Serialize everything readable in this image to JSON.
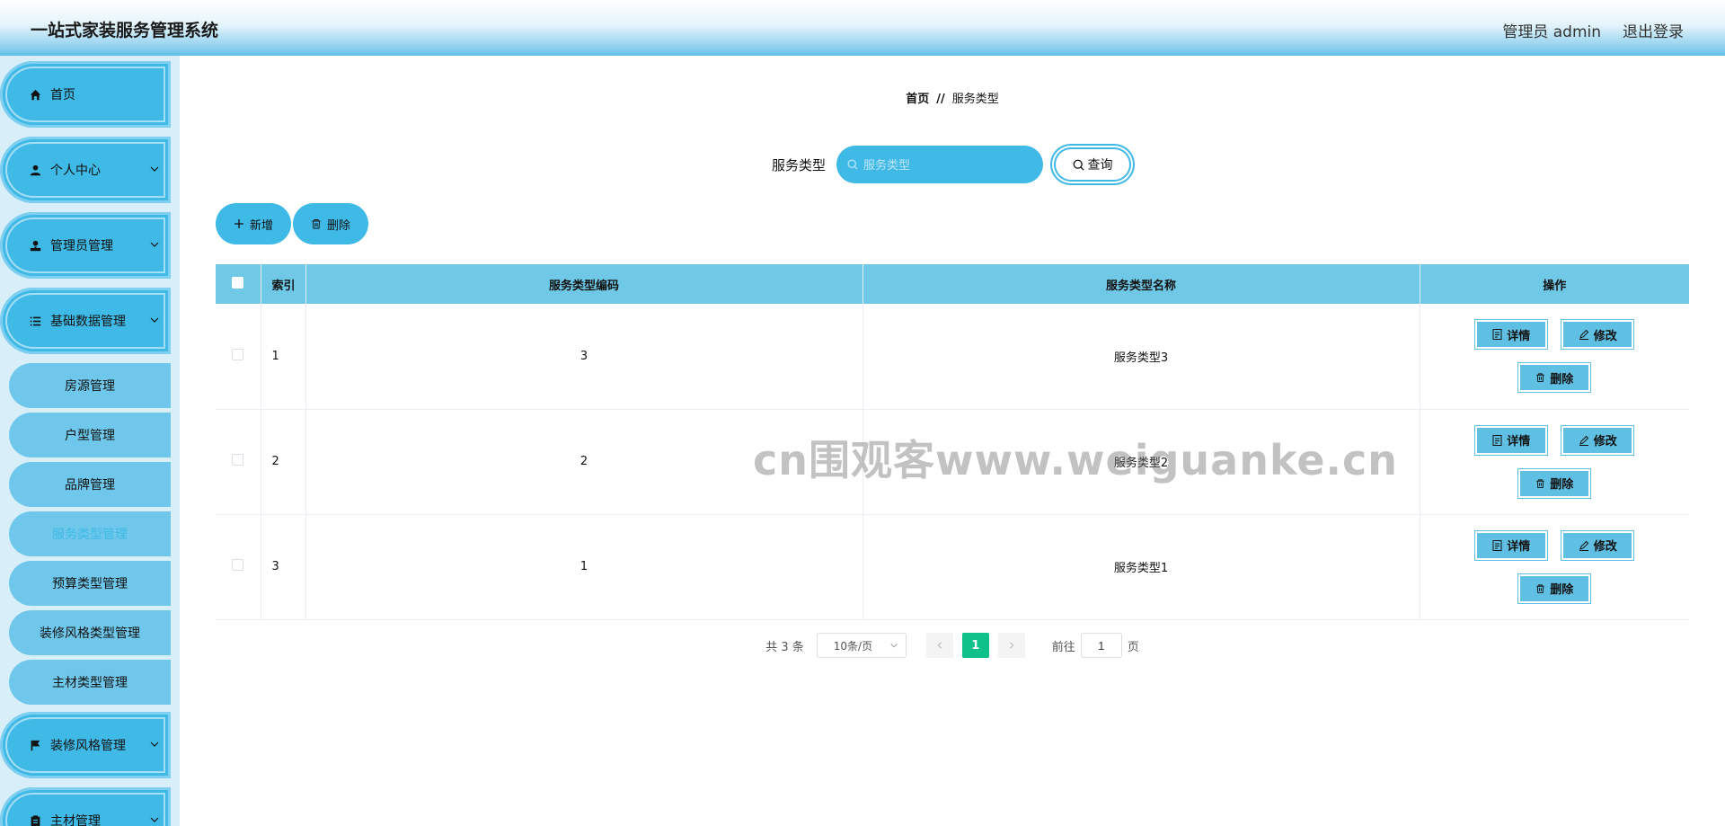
{
  "header": {
    "title": "一站式家装服务管理系统",
    "user_label": "管理员 admin",
    "logout_label": "退出登录"
  },
  "sidebar": {
    "items": [
      {
        "label": "首页",
        "icon": "home-icon",
        "has_children": false
      },
      {
        "label": "个人中心",
        "icon": "user-icon",
        "has_children": true
      },
      {
        "label": "管理员管理",
        "icon": "admin-icon",
        "has_children": true
      },
      {
        "label": "基础数据管理",
        "icon": "list-icon",
        "has_children": true,
        "expanded": true
      }
    ],
    "sub_items": [
      {
        "label": "房源管理",
        "active": false
      },
      {
        "label": "户型管理",
        "active": false
      },
      {
        "label": "品牌管理",
        "active": false
      },
      {
        "label": "服务类型管理",
        "active": true
      },
      {
        "label": "预算类型管理",
        "active": false
      },
      {
        "label": "装修风格类型管理",
        "active": false
      },
      {
        "label": "主材类型管理",
        "active": false
      }
    ],
    "items_after": [
      {
        "label": "装修风格管理",
        "icon": "flag-icon",
        "has_children": true
      },
      {
        "label": "主材管理",
        "icon": "clipboard-icon",
        "has_children": true
      }
    ]
  },
  "breadcrumb": {
    "home": "首页",
    "separator": "//",
    "current": "服务类型"
  },
  "search": {
    "label": "服务类型",
    "placeholder": "服务类型",
    "button_label": "查询"
  },
  "actions": {
    "add_label": "新增",
    "delete_label": "删除"
  },
  "table": {
    "columns": [
      "索引",
      "服务类型编码",
      "服务类型名称",
      "操作"
    ],
    "rows": [
      {
        "index": "1",
        "code": "3",
        "name": "服务类型3"
      },
      {
        "index": "2",
        "code": "2",
        "name": "服务类型2"
      },
      {
        "index": "3",
        "code": "1",
        "name": "服务类型1"
      }
    ],
    "row_actions": {
      "detail": "详情",
      "edit": "修改",
      "delete": "删除"
    }
  },
  "pagination": {
    "total_text": "共 3 条",
    "page_size": "10条/页",
    "current_page": "1",
    "goto_label": "前往",
    "goto_value": "1",
    "page_unit": "页"
  },
  "watermark": "cn围观客www.weiguanke.cn",
  "colors": {
    "accent": "#3fb9e6",
    "table_header": "#6fc8e6",
    "pager_active": "#10c28a"
  }
}
